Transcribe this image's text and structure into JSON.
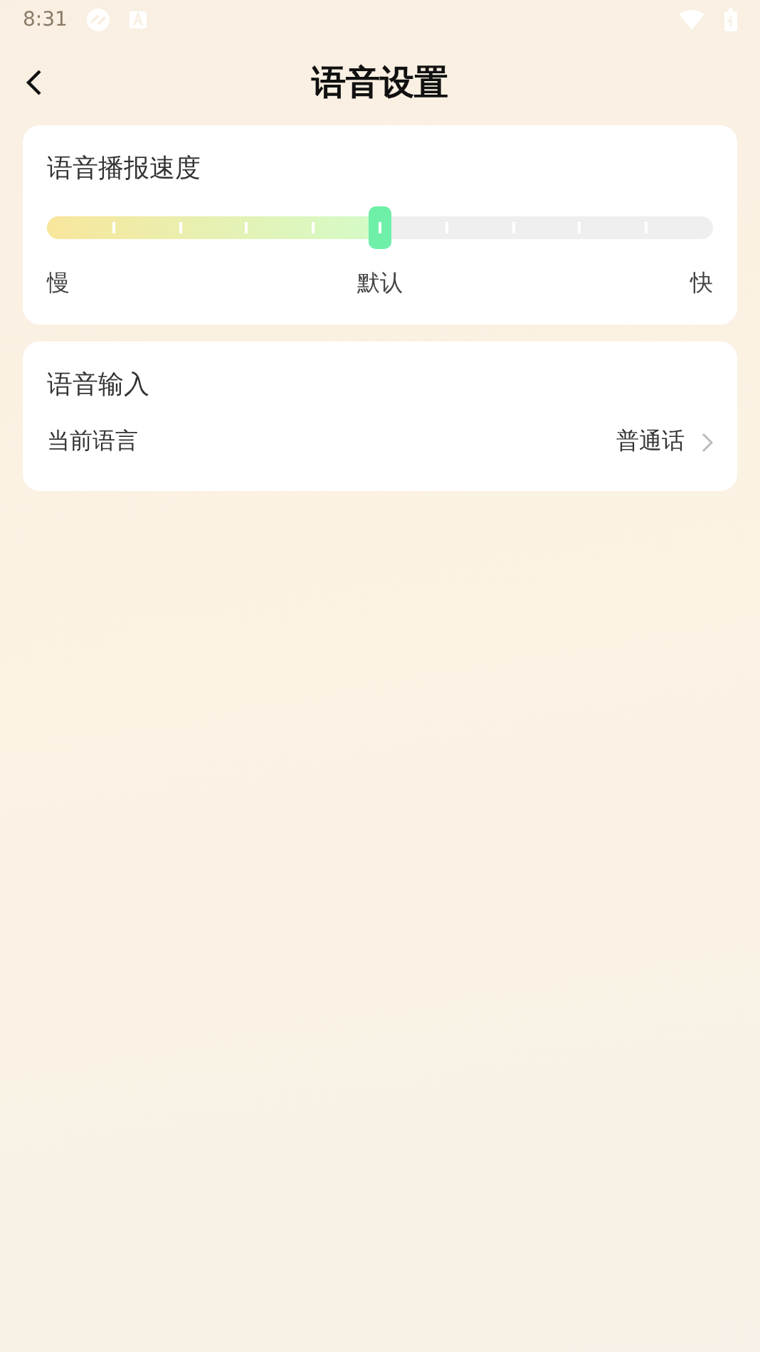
{
  "status_bar": {
    "time": "8:31"
  },
  "header": {
    "title": "语音设置"
  },
  "speed_card": {
    "title": "语音播报速度",
    "slider": {
      "level": 0.5
    },
    "labels": [
      "慢",
      "默认",
      "快"
    ]
  },
  "input_card": {
    "title": "语音输入",
    "row": {
      "label": "当前语言",
      "value": "普通话"
    }
  }
}
